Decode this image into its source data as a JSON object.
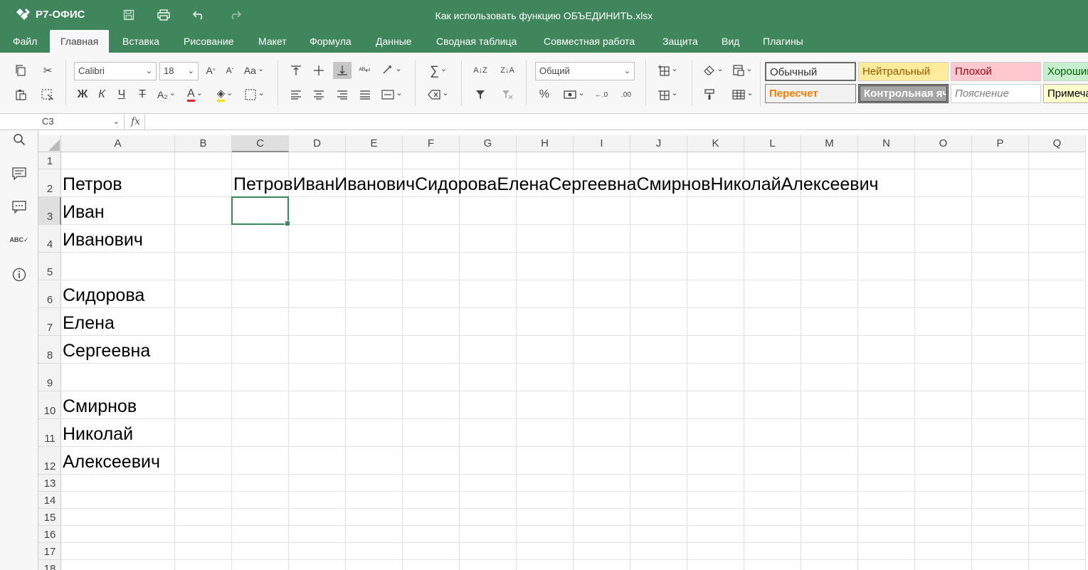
{
  "app": {
    "logo_text": "Р7-ОФИС",
    "doc_title": "Как использовать функцию ОБЪЕДИНИТЬ.xlsx",
    "brand_color": "#40865c"
  },
  "tabs": [
    "Файл",
    "Главная",
    "Вставка",
    "Рисование",
    "Макет",
    "Формула",
    "Данные",
    "Сводная таблица",
    "Совместная работа",
    "Защита",
    "Вид",
    "Плагины"
  ],
  "toolbar": {
    "font_name": "Calibri",
    "font_size": "18",
    "number_format": "Общий",
    "styles": [
      {
        "label": "Обычный",
        "bg": "#ffffff",
        "color": "#000000"
      },
      {
        "label": "Нейтральный",
        "bg": "#ffeb9c",
        "color": "#9c5700"
      },
      {
        "label": "Плохой",
        "bg": "#ffc7ce",
        "color": "#9c0006"
      },
      {
        "label": "Хороший",
        "bg": "#c6efce",
        "color": "#006100"
      },
      {
        "label": "Пересчет",
        "bg": "#f2f2f2",
        "color": "#fa7d00"
      },
      {
        "label": "Контрольная ячейка",
        "bg": "#a5a5a5",
        "color": "#ffffff"
      },
      {
        "label": "Пояснение",
        "bg": "#ffffff",
        "color": "#7f7f7f"
      },
      {
        "label": "Примечание",
        "bg": "#ffffcc",
        "color": "#000000"
      }
    ]
  },
  "formula_bar": {
    "cell_ref": "C3",
    "fx_label": "fx",
    "content": ""
  },
  "sheet": {
    "columns": [
      "A",
      "B",
      "C",
      "D",
      "E",
      "F",
      "G",
      "H",
      "I",
      "J",
      "K",
      "L",
      "M",
      "N",
      "O",
      "P",
      "Q"
    ],
    "rows": [
      "1",
      "2",
      "3",
      "4",
      "5",
      "6",
      "7",
      "8",
      "9",
      "10",
      "11",
      "12",
      "13",
      "14",
      "15",
      "16",
      "17",
      "18"
    ],
    "active_col": "C",
    "active_row": "3",
    "cells": {
      "A2": "Петров",
      "A3": "Иван",
      "A4": "Иванович",
      "A6": "Сидорова",
      "A7": "Елена",
      "A8": "Сергеевна",
      "A10": "Смирнов",
      "A11": "Николай",
      "A12": "Алексеевич",
      "C2": "ПетровИванИвановичСидороваЕленаСергеевнаСмирновНиколайАлексеевич"
    }
  }
}
